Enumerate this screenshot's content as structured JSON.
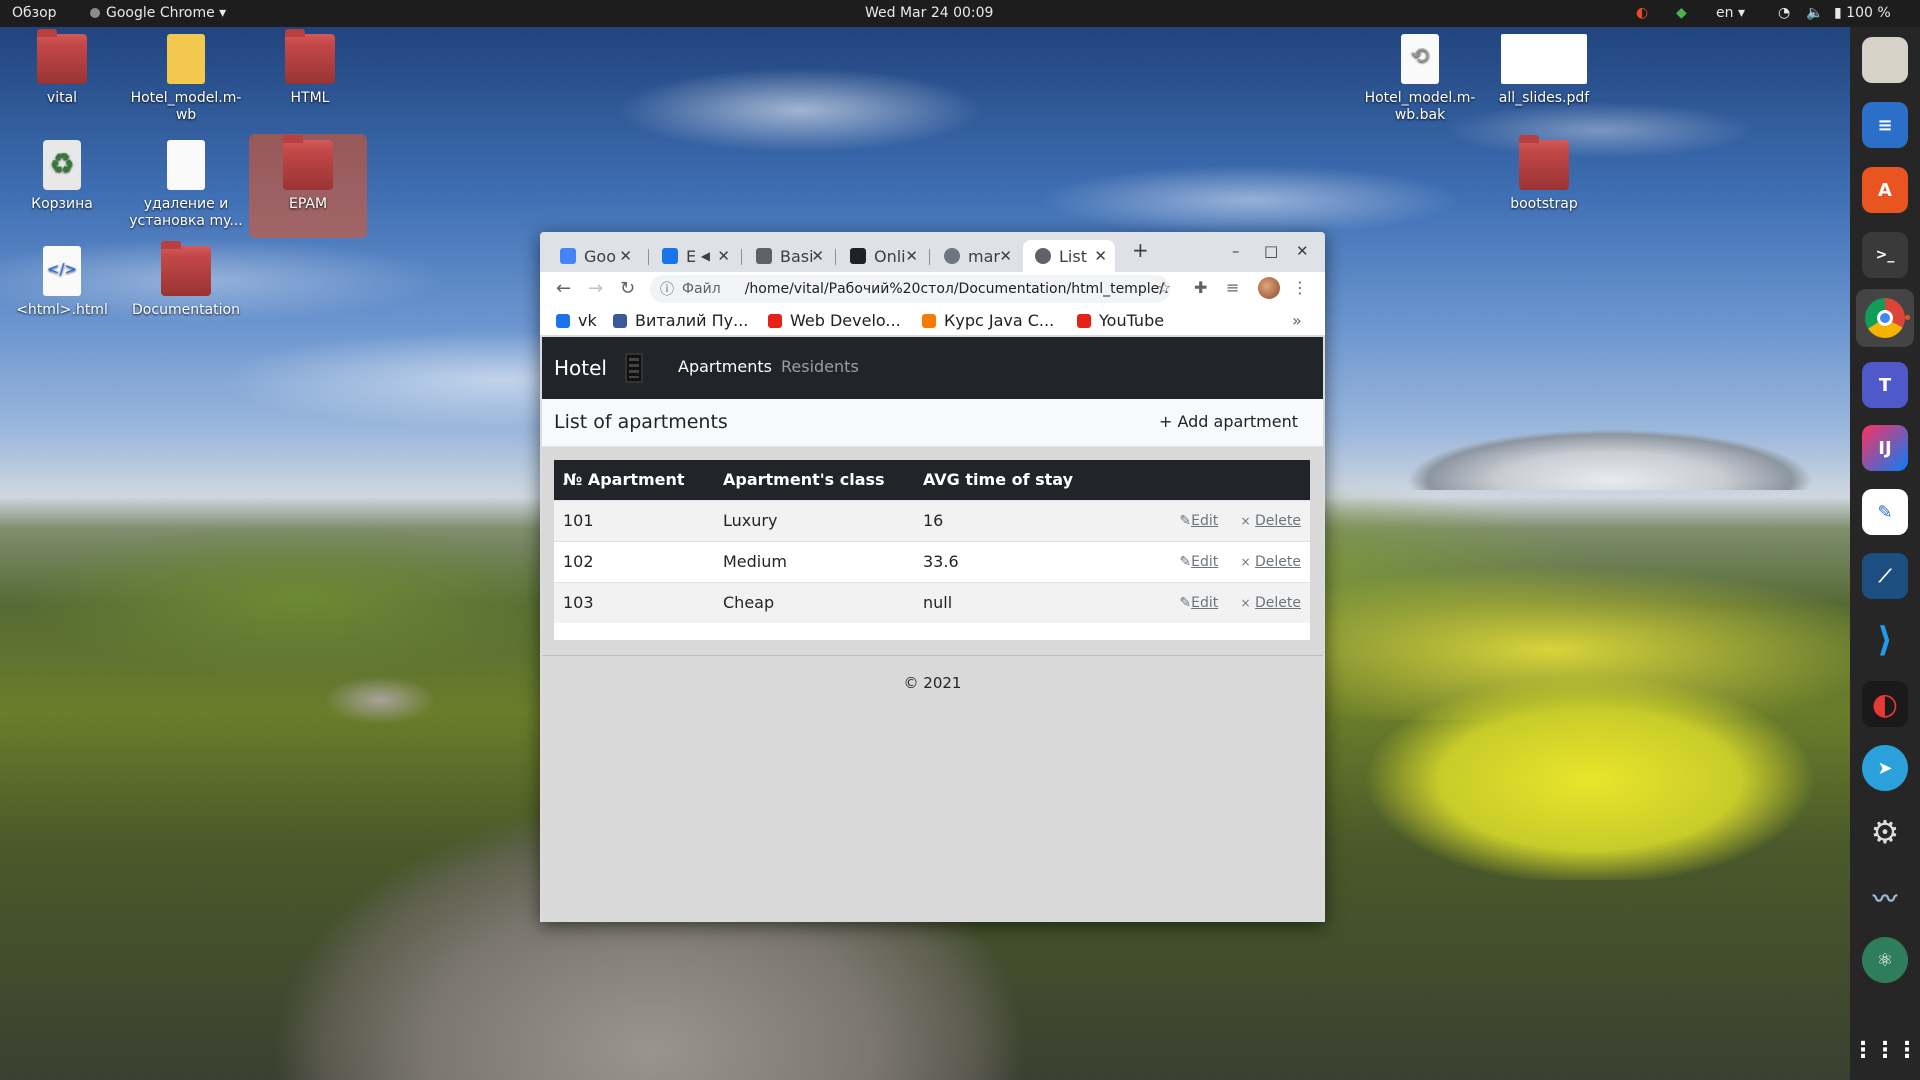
{
  "topbar": {
    "activities": "Обзор",
    "app_menu": "Google Chrome",
    "clock": "Wed Mar 24  00:09",
    "keyboard_layout": "en",
    "battery": "100 %"
  },
  "desktop": {
    "icons": [
      {
        "label": "vital",
        "icon": "home-folder-icon"
      },
      {
        "label": "Hotel_model.m-wb",
        "icon": "archive-icon"
      },
      {
        "label": "HTML",
        "icon": "folder-icon"
      },
      {
        "label": "Корзина",
        "icon": "trash-icon"
      },
      {
        "label": "удаление и установка my...",
        "icon": "text-file-icon"
      },
      {
        "label": "EPAM",
        "icon": "folder-icon"
      },
      {
        "label": "<html>.html",
        "icon": "html-file-icon"
      },
      {
        "label": "Documentation",
        "icon": "folder-icon"
      },
      {
        "label": "Hotel_model.m-wb.bak",
        "icon": "backup-file-icon"
      },
      {
        "label": "all_slides.pdf",
        "icon": "pdf-icon"
      },
      {
        "label": "bootstrap",
        "icon": "folder-icon"
      }
    ]
  },
  "browser": {
    "tabs": [
      {
        "label": "Goo",
        "icon": "google-translate-icon"
      },
      {
        "label": "E",
        "icon": "video-icon"
      },
      {
        "label": "Basi",
        "icon": "keyboard-icon"
      },
      {
        "label": "Onli",
        "icon": "d-icon"
      },
      {
        "label": "mar",
        "icon": "github-icon"
      },
      {
        "label": "List",
        "icon": "globe-icon"
      }
    ],
    "address_scheme": "Файл",
    "address_url": "/home/vital/Рабочий%20стол/Documentation/html_temple/...",
    "bookmarks": [
      {
        "label": "vk",
        "color": "#1a73e8"
      },
      {
        "label": "Виталий Пу...",
        "color": "#3b5998"
      },
      {
        "label": "Web Develo...",
        "color": "#e62117"
      },
      {
        "label": "Курс Java C...",
        "color": "#f57c00"
      },
      {
        "label": "YouTube",
        "color": "#e62117"
      }
    ],
    "bookmarks_more": "»"
  },
  "page": {
    "brand": "Hotel",
    "nav": {
      "apartments": "Apartments",
      "residents": "Residents"
    },
    "list_title": "List of apartments",
    "add_button": "+ Add apartment",
    "table": {
      "headers": [
        "№ Apartment",
        "Apartment's class",
        "AVG time of stay"
      ],
      "rows": [
        {
          "number": "101",
          "class": "Luxury",
          "avg": "16"
        },
        {
          "number": "102",
          "class": "Medium",
          "avg": "33.6"
        },
        {
          "number": "103",
          "class": "Cheap",
          "avg": "null"
        }
      ],
      "edit_label": "Edit",
      "delete_label": "Delete"
    },
    "footer": "© 2021"
  }
}
